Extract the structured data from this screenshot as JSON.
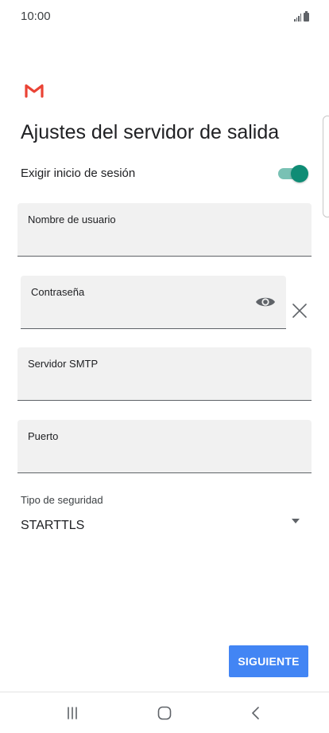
{
  "status_bar": {
    "time": "10:00",
    "icons": [
      "signal-icon",
      "battery-icon"
    ]
  },
  "app": {
    "logo": "gmail-logo",
    "title": "Ajustes del servidor de salida"
  },
  "login_toggle": {
    "label": "Exigir inicio de sesión",
    "enabled": true
  },
  "fields": {
    "username": {
      "label": "Nombre de usuario",
      "value": ""
    },
    "password": {
      "label": "Contraseña",
      "value": "",
      "icon": "eye-icon"
    },
    "smtp_server": {
      "label": "Servidor SMTP",
      "value": ""
    },
    "port": {
      "label": "Puerto",
      "value": ""
    }
  },
  "security": {
    "label": "Tipo de seguridad",
    "value": "STARTTLS"
  },
  "actions": {
    "next_label": "SIGUIENTE"
  },
  "nav_bar": {
    "buttons": [
      "recents-icon",
      "home-icon",
      "back-icon"
    ]
  },
  "colors": {
    "accent": "#4285f4",
    "toggle_on": "#0f8c75",
    "gmail_red": "#ea4335"
  }
}
